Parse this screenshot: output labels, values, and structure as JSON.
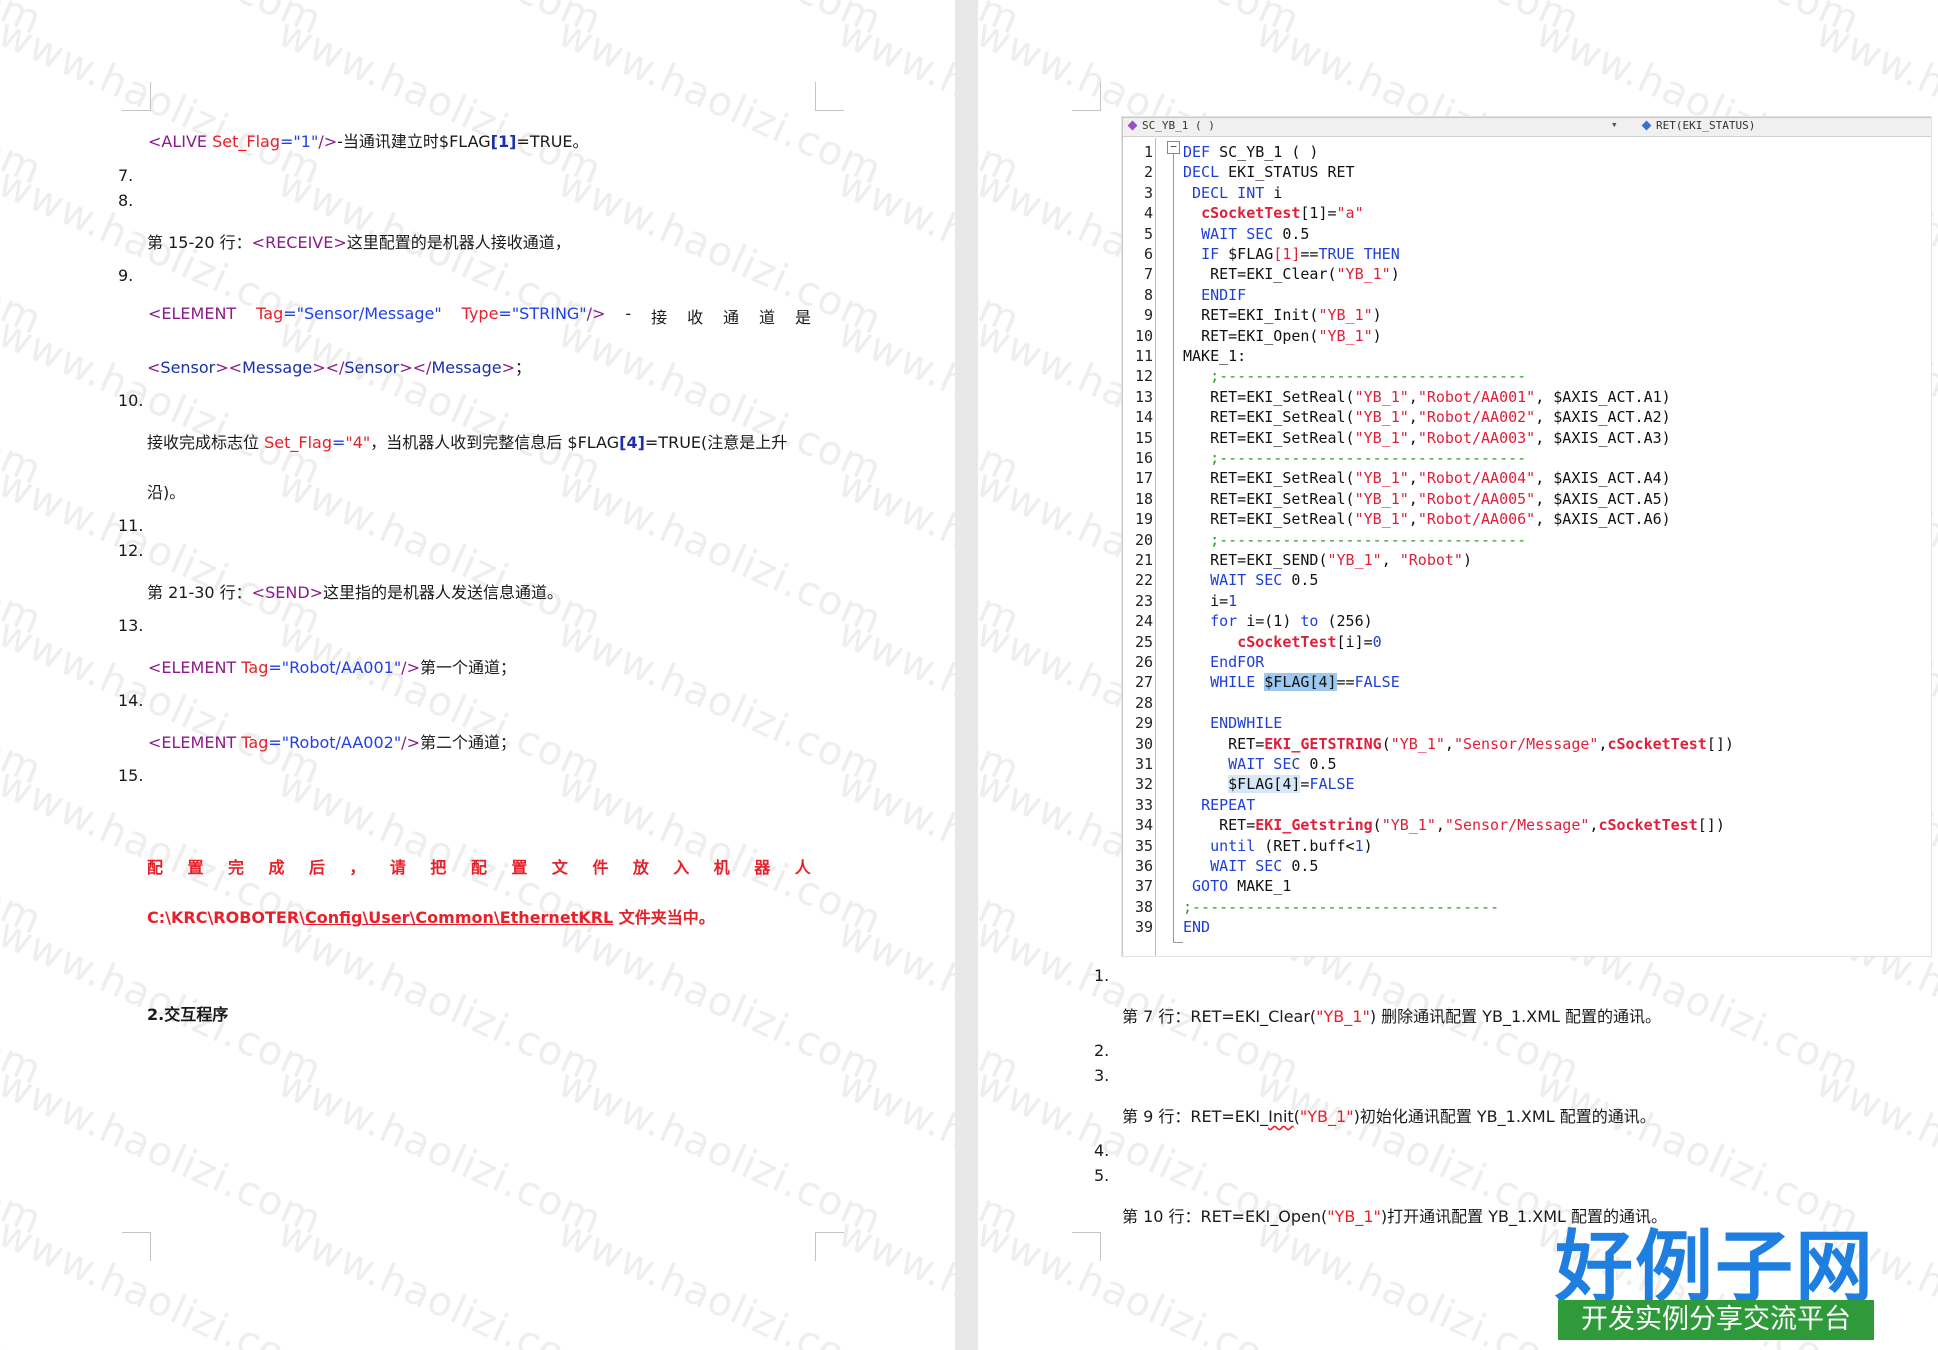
{
  "left_page": {
    "line_alive": {
      "open": "<ALIVE ",
      "attr": "Set_Flag",
      "eq": "=",
      "value": "\"1\"",
      "close": "/>",
      "text_a": "-当通讯建立时$FLAG",
      "bracket_open": "[",
      "idx": "1",
      "bracket_close": "]",
      "text_b": "=TRUE。"
    },
    "num_7": "7.",
    "num_8": "8.",
    "receive": {
      "prefix": "第 15-20 行：",
      "tag": "<RECEIVE>",
      "suffix": "这里配置的是机器人接收通道，"
    },
    "num_9": "9.",
    "element_sensor": {
      "open": "<ELEMENT",
      "tag_attr": "Tag",
      "eq1": "=",
      "tag_val": "\"Sensor/Message\"",
      "type_attr": "Type",
      "eq2": "=",
      "type_val": "\"STRING\"",
      "close": "/>",
      "chars": [
        "-",
        "接",
        "收",
        "通",
        "道",
        "是"
      ]
    },
    "sensor_message": {
      "lt1": "<",
      "s1": "Sensor",
      "gt1": ">",
      "lt2": "<",
      "s2": "Message",
      "gt2": ">",
      "lt3": "</",
      "s3": "Sensor",
      "gt3": ">",
      "lt4": "</",
      "s4": "Message",
      "gt4": ">",
      "tail": "；"
    },
    "num_10": "10.",
    "receive_done": {
      "prefix": "接收完成标志位 ",
      "attr": "Set_Flag",
      "eq": "=",
      "value": "\"4\"",
      "middle": "，当机器人收到完整信息后 $FLAG",
      "bracket_open": "[",
      "idx": "4",
      "bracket_close": "]",
      "suffix": "=TRUE(注意是上升"
    },
    "receive_done_2": "沿)。",
    "num_11": "11.",
    "num_12": "12.",
    "send": {
      "prefix": "第 21-30 行：",
      "tag": "<SEND>",
      "suffix": "这里指的是机器人发送信息通道。"
    },
    "num_13": "13.",
    "element_aa001": {
      "open": "<ELEMENT ",
      "attr": "Tag",
      "eq": "=",
      "value": "\"Robot/AA001\"",
      "close": "/>",
      "desc": "第一个通道；"
    },
    "num_14": "14.",
    "element_aa002": {
      "open": "<ELEMENT ",
      "attr": "Tag",
      "eq": "=",
      "value": "\"Robot/AA002\"",
      "close": "/>",
      "desc": "第二个通道；"
    },
    "num_15": "15.",
    "note_chars": [
      "配",
      "置",
      "完",
      "成",
      "后",
      "，",
      "请",
      "把",
      "配",
      "置",
      "文",
      "件",
      "放",
      "入",
      "机",
      "器",
      "人"
    ],
    "note_path": {
      "p1": "C:\\KRC\\ROBOTER\\",
      "p2": "Config",
      "p3": "\\",
      "p4": "User",
      "p5": "\\",
      "p6": "Common",
      "p7": "\\",
      "p8": "EthernetKRL",
      "p9": " 文件夹当中。"
    },
    "section_title": "2.交互程序"
  },
  "editor": {
    "toolbar_left": "SC_YB_1 ( )",
    "toolbar_arrow": "▾",
    "toolbar_right": "RET(EKI_STATUS)",
    "fold_symbol": "−",
    "line_numbers": [
      "1",
      "2",
      "3",
      "4",
      "5",
      "6",
      "7",
      "8",
      "9",
      "10",
      "11",
      "12",
      "13",
      "14",
      "15",
      "16",
      "17",
      "18",
      "19",
      "20",
      "21",
      "22",
      "23",
      "24",
      "25",
      "26",
      "27",
      "28",
      "29",
      "30",
      "31",
      "32",
      "33",
      "34",
      "35",
      "36",
      "37",
      "38",
      "39"
    ],
    "code": {
      "l1_kw": "DEF",
      "l1_rest": " SC_YB_1 ( )",
      "l2_kw": "DECL",
      "l2_rest": " EKI_STATUS RET",
      "l3_kw": "DECL INT",
      "l3_rest": " i",
      "l4_var": "cSocketTest",
      "l4_a": "[1]=",
      "l4_str": "\"a\"",
      "l5_kw": "WAIT SEC",
      "l5_rest": " 0.5",
      "l6_kw1": "IF",
      "l6_a": " $FLAG",
      "l6_b": "[1]",
      "l6_c": "==",
      "l6_kw2": "TRUE THEN",
      "l7_a": "RET=EKI_Clear(",
      "l7_str": "\"YB_1\"",
      "l7_b": ")",
      "l8_kw": "ENDIF",
      "l9_a": "RET=EKI_Init(",
      "l9_str": "\"YB_1\"",
      "l9_b": ")",
      "l10_a": "RET=EKI_Open(",
      "l10_str": "\"YB_1\"",
      "l10_b": ")",
      "l11": "MAKE_1:",
      "l12": ";----------------------------------",
      "l13_a": "RET=EKI_SetReal(",
      "l13_s1": "\"YB_1\"",
      "l13_c": ",",
      "l13_s2": "\"Robot/AA001\"",
      "l13_b": ", $AXIS_ACT.A1)",
      "l14_a": "RET=EKI_SetReal(",
      "l14_s1": "\"YB_1\"",
      "l14_c": ",",
      "l14_s2": "\"Robot/AA002\"",
      "l14_b": ", $AXIS_ACT.A2)",
      "l15_a": "RET=EKI_SetReal(",
      "l15_s1": "\"YB_1\"",
      "l15_c": ",",
      "l15_s2": "\"Robot/AA003\"",
      "l15_b": ", $AXIS_ACT.A3)",
      "l16": ";----------------------------------",
      "l17_a": "RET=EKI_SetReal(",
      "l17_s1": "\"YB_1\"",
      "l17_c": ",",
      "l17_s2": "\"Robot/AA004\"",
      "l17_b": ", $AXIS_ACT.A4)",
      "l18_a": "RET=EKI_SetReal(",
      "l18_s1": "\"YB_1\"",
      "l18_c": ",",
      "l18_s2": "\"Robot/AA005\"",
      "l18_b": ", $AXIS_ACT.A5)",
      "l19_a": "RET=EKI_SetReal(",
      "l19_s1": "\"YB_1\"",
      "l19_c": ",",
      "l19_s2": "\"Robot/AA006\"",
      "l19_b": ", $AXIS_ACT.A6)",
      "l20": ";----------------------------------",
      "l21_a": "RET=EKI_SEND(",
      "l21_s1": "\"YB_1\"",
      "l21_c": ", ",
      "l21_s2": "\"Robot\"",
      "l21_b": ")",
      "l22_kw": "WAIT SEC",
      "l22_rest": " 0.5",
      "l23_a": "i=",
      "l23_b": "1",
      "l24_kw1": "for",
      "l24_a": " i=",
      "l24_b": "(1)",
      "l24_kw2": " to",
      "l24_c": " ",
      "l24_d": "(256)",
      "l25_var": "cSocketTest",
      "l25_a": "[i]=",
      "l25_b": "0",
      "l26_kw": "EndFOR",
      "l27_kw": "WHILE",
      "l27_sp": " ",
      "l27_hl": "$FLAG[4]",
      "l27_a": "==",
      "l27_kw2": "FALSE",
      "l29_kw": "ENDWHILE",
      "l30_a": "RET=",
      "l30_var": "EKI_GETSTRING",
      "l30_b": "(",
      "l30_s1": "\"YB_1\"",
      "l30_c": ",",
      "l30_s2": "\"Sensor/Message\"",
      "l30_d": ",",
      "l30_var2": "cSocketTest",
      "l30_e": "[])",
      "l31_kw": "WAIT SEC",
      "l31_rest": " 0.5",
      "l32_hl": "$FLAG[4]",
      "l32_a": "=",
      "l32_kw": "FALSE",
      "l33_kw": "REPEAT",
      "l34_a": "RET=",
      "l34_var": "EKI_Getstring",
      "l34_b": "(",
      "l34_s1": "\"YB_1\"",
      "l34_c": ",",
      "l34_s2": "\"Sensor/Message\"",
      "l34_d": ",",
      "l34_var2": "cSocketTest",
      "l34_e": "[])",
      "l35_kw": "until",
      "l35_a": " (RET.buff<",
      "l35_b": "1",
      "l35_c": ")",
      "l36_kw": "WAIT SEC",
      "l36_rest": " 0.5",
      "l37_kw": "GOTO",
      "l37_rest": " MAKE_1",
      "l38": ";----------------------------------",
      "l39_kw": "END"
    }
  },
  "right_page": {
    "num_1": "1.",
    "expl_7": {
      "prefix": "第 7 行：RET=EKI_Clear(",
      "str": "\"YB_1\"",
      "suffix": ") 删除通讯配置 YB_1.XML 配置的通讯。"
    },
    "num_2": "2.",
    "num_3": "3.",
    "expl_9": {
      "prefix": "第 9 行：RET=EKI_",
      "wavy": "Init",
      "mid": "(",
      "str": "\"YB_1\"",
      "suffix": ")初始化通讯配置 YB_1.XML 配置的通讯。"
    },
    "num_4": "4.",
    "num_5": "5.",
    "expl_10": {
      "prefix": "第 10 行：RET=EKI_Open(",
      "str": "\"YB_1\"",
      "suffix": ")打开通讯配置 YB_1.XML 配置的通讯。"
    }
  },
  "logo": {
    "title": "好例子网",
    "subtitle": "开发实例分享交流平台"
  },
  "watermark": "www.haolizi.com"
}
